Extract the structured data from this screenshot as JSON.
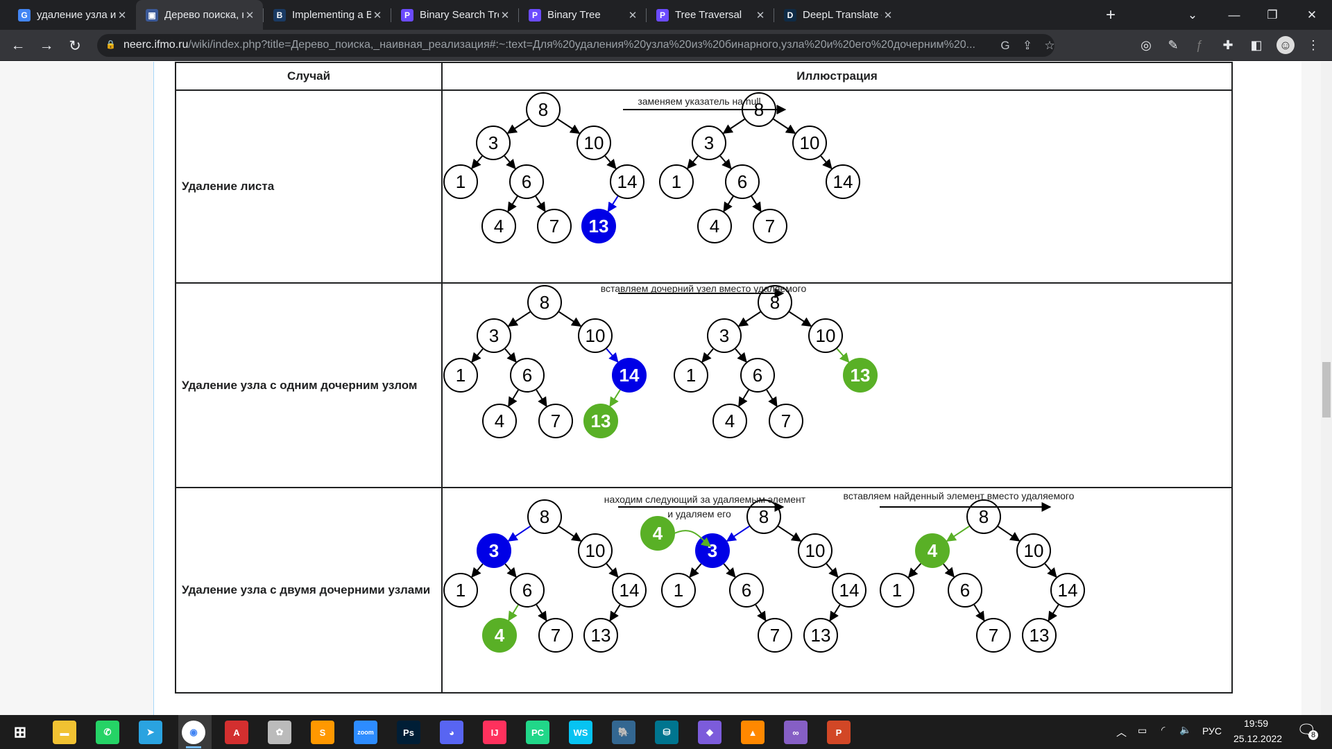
{
  "tabs": [
    {
      "title": "удаление узла из би",
      "favicon": "google-icon",
      "color": "#4285f4",
      "letter": "G"
    },
    {
      "title": "Дерево поиска, наив",
      "favicon": "neerc-icon",
      "color": "#3b5998",
      "letter": "▣"
    },
    {
      "title": "Implementing a Binar",
      "favicon": "baeldung-icon",
      "color": "#1a3a63",
      "letter": "B"
    },
    {
      "title": "Binary Search Tree",
      "favicon": "programiz-icon",
      "color": "#6b4bff",
      "letter": "P"
    },
    {
      "title": "Binary Tree",
      "favicon": "programiz-icon",
      "color": "#6b4bff",
      "letter": "P"
    },
    {
      "title": "Tree Traversal",
      "favicon": "programiz-icon",
      "color": "#6b4bff",
      "letter": "P"
    },
    {
      "title": "DeepL Translate – Са",
      "favicon": "deepl-icon",
      "color": "#0f2b46",
      "letter": "D"
    }
  ],
  "address": {
    "host": "neerc.ifmo.ru",
    "path": "/wiki/index.php?title=Дерево_поиска,_наивная_реализация#:~:text=Для%20удаления%20узла%20из%20бинарного,узла%20и%20его%20дочерним%20..."
  },
  "table": {
    "header_case": "Случай",
    "header_illustration": "Иллюстрация",
    "rows": [
      {
        "case": "Удаление листа",
        "label": "заменяем указатель на null"
      },
      {
        "case": "Удаление узла с одним дочерним узлом",
        "label": "вставляем дочерний узел вместо удаляемого"
      },
      {
        "case": "Удаление узла с двумя дочерними узлами",
        "label1": "находим следующий за удаляемым элемент",
        "label1b": "и удаляем его",
        "label2": "вставляем найденный элемент вместо удаляемого"
      }
    ]
  },
  "colors": {
    "blue": "#0000e6",
    "green": "#59b026"
  },
  "taskbar": {
    "icons": [
      "file-explorer-icon",
      "whatsapp-icon",
      "telegram-icon",
      "chrome-icon",
      "acrobat-icon",
      "paint-icon",
      "sublime-icon",
      "zoom-icon",
      "photoshop-icon",
      "discord-icon",
      "intellij-icon",
      "pycharm-icon",
      "webstorm-icon",
      "postgres-icon",
      "mysql-workbench-icon",
      "obsidian-icon",
      "vlc-icon",
      "visual-studio-icon",
      "powerpoint-icon"
    ],
    "lang": "РУС",
    "time": "19:59",
    "date": "25.12.2022",
    "notifications": "8"
  }
}
